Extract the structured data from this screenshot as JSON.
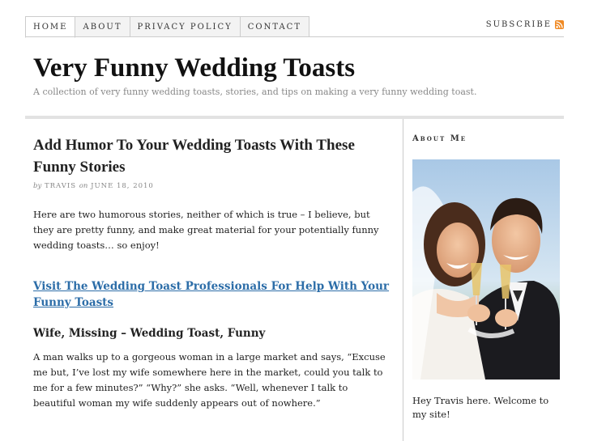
{
  "nav": {
    "items": [
      {
        "label": "HOME"
      },
      {
        "label": "ABOUT"
      },
      {
        "label": "PRIVACY POLICY"
      },
      {
        "label": "CONTACT"
      }
    ],
    "subscribe_label": "SUBSCRIBE"
  },
  "header": {
    "title": "Very Funny Wedding Toasts",
    "tagline": "A collection of very funny wedding toasts, stories, and tips on making a very funny wedding toast."
  },
  "post": {
    "title": "Add Humor To Your Wedding Toasts With These Funny Stories",
    "byline": {
      "by": "by",
      "author": "TRAVIS",
      "on": "on",
      "date": "JUNE 18, 2010"
    },
    "intro": "Here are two humorous stories, neither of which is true – I believe, but they are pretty funny, and make great material for your potentially funny wedding toasts… so enjoy!",
    "promo_link": "Visit The Wedding Toast Professionals For Help With Your Funny Toasts",
    "subheading": "Wife, Missing – Wedding Toast, Funny",
    "story": "A man walks up to a gorgeous woman in a large market and says, “Excuse me but, I’ve lost my wife somewhere here in the market, could you talk to me for a few minutes?” “Why?” she asks. “Well, whenever I talk to beautiful woman my wife suddenly appears out of nowhere.”"
  },
  "sidebar": {
    "widget_title": "About Me",
    "photo": "bride-and-groom-toasting-photo",
    "welcome": "Hey Travis here. Welcome to my site!"
  },
  "colors": {
    "link": "#2c6da8",
    "rss": "#f08a24",
    "rule": "#e2e2e2"
  }
}
